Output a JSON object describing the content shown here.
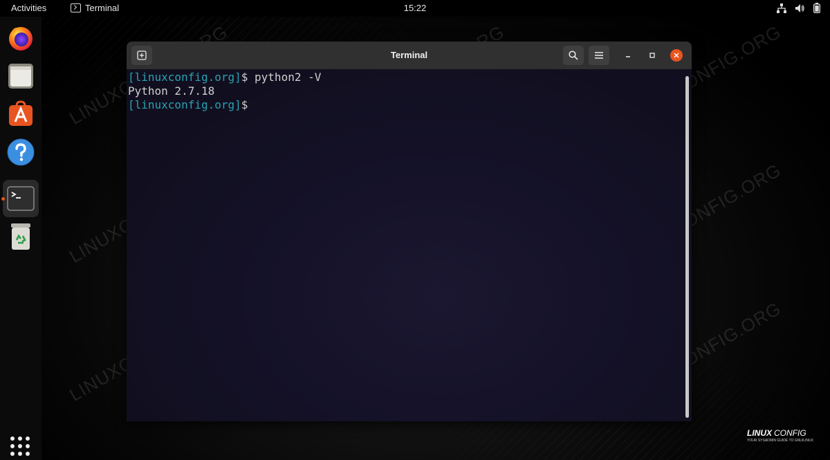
{
  "topbar": {
    "activities": "Activities",
    "app_name": "Terminal",
    "clock": "15:22",
    "tray_icons": [
      "network-icon",
      "volume-icon",
      "battery-icon"
    ]
  },
  "dock": {
    "items": [
      {
        "name": "firefox-icon"
      },
      {
        "name": "files-icon"
      },
      {
        "name": "software-icon"
      },
      {
        "name": "help-icon"
      },
      {
        "name": "terminal-icon",
        "active": true
      },
      {
        "name": "trash-icon"
      }
    ],
    "show_apps_icon": "apps-grid-icon"
  },
  "terminal": {
    "title": "Terminal",
    "lines": [
      {
        "prompt": "[linuxconfig.org]",
        "text": "$ python2 -V"
      },
      {
        "prompt": "",
        "text": "Python 2.7.18"
      },
      {
        "prompt": "[linuxconfig.org]",
        "text": "$"
      }
    ]
  },
  "watermark": "LINUXCONFIG.ORG",
  "brand": {
    "logo": "LINUXCONFIG",
    "tagline": "YOUR SYSADMIN GUIDE TO GNU/LINUX"
  },
  "colors": {
    "prompt": "#2aa1b3",
    "accent": "#e95420",
    "close_button": "#e95420"
  }
}
